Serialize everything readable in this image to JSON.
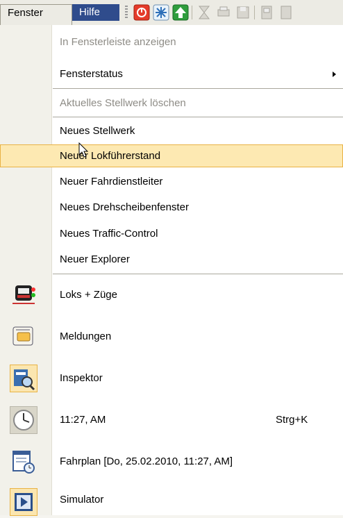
{
  "menubar": {
    "fenster": "Fenster",
    "hilfe": "Hilfe"
  },
  "toolbar_icons": [
    "stop-icon",
    "snowflake-icon",
    "up-arrow-icon",
    "hourglass-icon",
    "print-icon",
    "floppy-icon",
    "device-icon"
  ],
  "menu": {
    "in_fensterleiste": "In Fensterleiste anzeigen",
    "fensterstatus": "Fensterstatus",
    "stellwerk_loeschen": "Aktuelles Stellwerk löschen",
    "neues_stellwerk": "Neues Stellwerk",
    "neuer_lokfuehrerstand": "Neuer Lokführerstand",
    "neuer_fahrdienstleiter": "Neuer Fahrdienstleiter",
    "neues_drehscheibenfenster": "Neues Drehscheibenfenster",
    "neues_traffic_control": "Neues Traffic-Control",
    "neuer_explorer": "Neuer Explorer",
    "loks_zuege": "Loks + Züge",
    "meldungen": "Meldungen",
    "inspektor": "Inspektor",
    "uhr": "11:27, AM",
    "uhr_shortcut": "Strg+K",
    "fahrplan": "Fahrplan [Do, 25.02.2010, 11:27, AM]",
    "simulator": "Simulator"
  },
  "colors": {
    "highlight_bg": "#fde9b2",
    "highlight_border": "#e8b244",
    "menubar_active": "#2f4c8c"
  }
}
